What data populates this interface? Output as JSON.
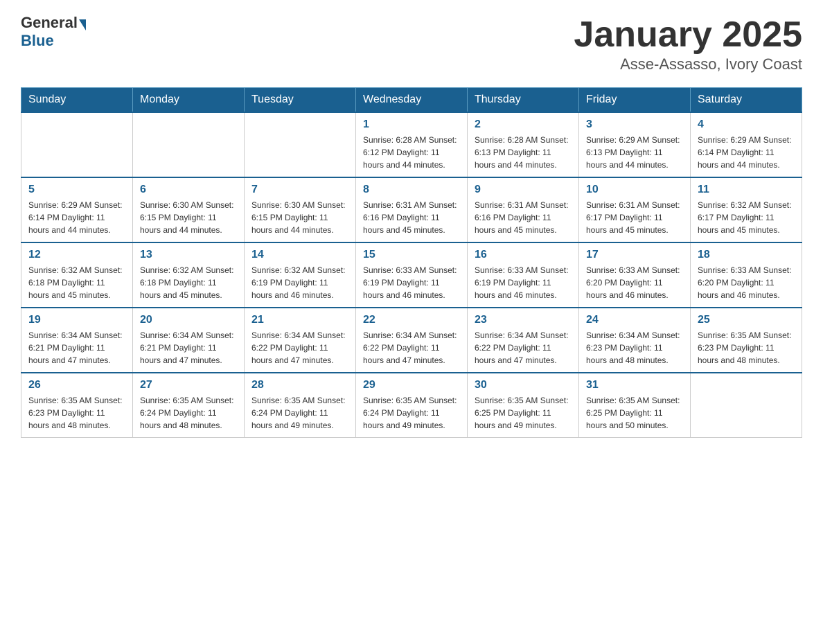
{
  "header": {
    "logo": {
      "general": "General",
      "blue": "Blue"
    },
    "title": "January 2025",
    "subtitle": "Asse-Assasso, Ivory Coast"
  },
  "days_of_week": [
    "Sunday",
    "Monday",
    "Tuesday",
    "Wednesday",
    "Thursday",
    "Friday",
    "Saturday"
  ],
  "weeks": [
    [
      {
        "day": "",
        "info": ""
      },
      {
        "day": "",
        "info": ""
      },
      {
        "day": "",
        "info": ""
      },
      {
        "day": "1",
        "info": "Sunrise: 6:28 AM\nSunset: 6:12 PM\nDaylight: 11 hours\nand 44 minutes."
      },
      {
        "day": "2",
        "info": "Sunrise: 6:28 AM\nSunset: 6:13 PM\nDaylight: 11 hours\nand 44 minutes."
      },
      {
        "day": "3",
        "info": "Sunrise: 6:29 AM\nSunset: 6:13 PM\nDaylight: 11 hours\nand 44 minutes."
      },
      {
        "day": "4",
        "info": "Sunrise: 6:29 AM\nSunset: 6:14 PM\nDaylight: 11 hours\nand 44 minutes."
      }
    ],
    [
      {
        "day": "5",
        "info": "Sunrise: 6:29 AM\nSunset: 6:14 PM\nDaylight: 11 hours\nand 44 minutes."
      },
      {
        "day": "6",
        "info": "Sunrise: 6:30 AM\nSunset: 6:15 PM\nDaylight: 11 hours\nand 44 minutes."
      },
      {
        "day": "7",
        "info": "Sunrise: 6:30 AM\nSunset: 6:15 PM\nDaylight: 11 hours\nand 44 minutes."
      },
      {
        "day": "8",
        "info": "Sunrise: 6:31 AM\nSunset: 6:16 PM\nDaylight: 11 hours\nand 45 minutes."
      },
      {
        "day": "9",
        "info": "Sunrise: 6:31 AM\nSunset: 6:16 PM\nDaylight: 11 hours\nand 45 minutes."
      },
      {
        "day": "10",
        "info": "Sunrise: 6:31 AM\nSunset: 6:17 PM\nDaylight: 11 hours\nand 45 minutes."
      },
      {
        "day": "11",
        "info": "Sunrise: 6:32 AM\nSunset: 6:17 PM\nDaylight: 11 hours\nand 45 minutes."
      }
    ],
    [
      {
        "day": "12",
        "info": "Sunrise: 6:32 AM\nSunset: 6:18 PM\nDaylight: 11 hours\nand 45 minutes."
      },
      {
        "day": "13",
        "info": "Sunrise: 6:32 AM\nSunset: 6:18 PM\nDaylight: 11 hours\nand 45 minutes."
      },
      {
        "day": "14",
        "info": "Sunrise: 6:32 AM\nSunset: 6:19 PM\nDaylight: 11 hours\nand 46 minutes."
      },
      {
        "day": "15",
        "info": "Sunrise: 6:33 AM\nSunset: 6:19 PM\nDaylight: 11 hours\nand 46 minutes."
      },
      {
        "day": "16",
        "info": "Sunrise: 6:33 AM\nSunset: 6:19 PM\nDaylight: 11 hours\nand 46 minutes."
      },
      {
        "day": "17",
        "info": "Sunrise: 6:33 AM\nSunset: 6:20 PM\nDaylight: 11 hours\nand 46 minutes."
      },
      {
        "day": "18",
        "info": "Sunrise: 6:33 AM\nSunset: 6:20 PM\nDaylight: 11 hours\nand 46 minutes."
      }
    ],
    [
      {
        "day": "19",
        "info": "Sunrise: 6:34 AM\nSunset: 6:21 PM\nDaylight: 11 hours\nand 47 minutes."
      },
      {
        "day": "20",
        "info": "Sunrise: 6:34 AM\nSunset: 6:21 PM\nDaylight: 11 hours\nand 47 minutes."
      },
      {
        "day": "21",
        "info": "Sunrise: 6:34 AM\nSunset: 6:22 PM\nDaylight: 11 hours\nand 47 minutes."
      },
      {
        "day": "22",
        "info": "Sunrise: 6:34 AM\nSunset: 6:22 PM\nDaylight: 11 hours\nand 47 minutes."
      },
      {
        "day": "23",
        "info": "Sunrise: 6:34 AM\nSunset: 6:22 PM\nDaylight: 11 hours\nand 47 minutes."
      },
      {
        "day": "24",
        "info": "Sunrise: 6:34 AM\nSunset: 6:23 PM\nDaylight: 11 hours\nand 48 minutes."
      },
      {
        "day": "25",
        "info": "Sunrise: 6:35 AM\nSunset: 6:23 PM\nDaylight: 11 hours\nand 48 minutes."
      }
    ],
    [
      {
        "day": "26",
        "info": "Sunrise: 6:35 AM\nSunset: 6:23 PM\nDaylight: 11 hours\nand 48 minutes."
      },
      {
        "day": "27",
        "info": "Sunrise: 6:35 AM\nSunset: 6:24 PM\nDaylight: 11 hours\nand 48 minutes."
      },
      {
        "day": "28",
        "info": "Sunrise: 6:35 AM\nSunset: 6:24 PM\nDaylight: 11 hours\nand 49 minutes."
      },
      {
        "day": "29",
        "info": "Sunrise: 6:35 AM\nSunset: 6:24 PM\nDaylight: 11 hours\nand 49 minutes."
      },
      {
        "day": "30",
        "info": "Sunrise: 6:35 AM\nSunset: 6:25 PM\nDaylight: 11 hours\nand 49 minutes."
      },
      {
        "day": "31",
        "info": "Sunrise: 6:35 AM\nSunset: 6:25 PM\nDaylight: 11 hours\nand 50 minutes."
      },
      {
        "day": "",
        "info": ""
      }
    ]
  ]
}
